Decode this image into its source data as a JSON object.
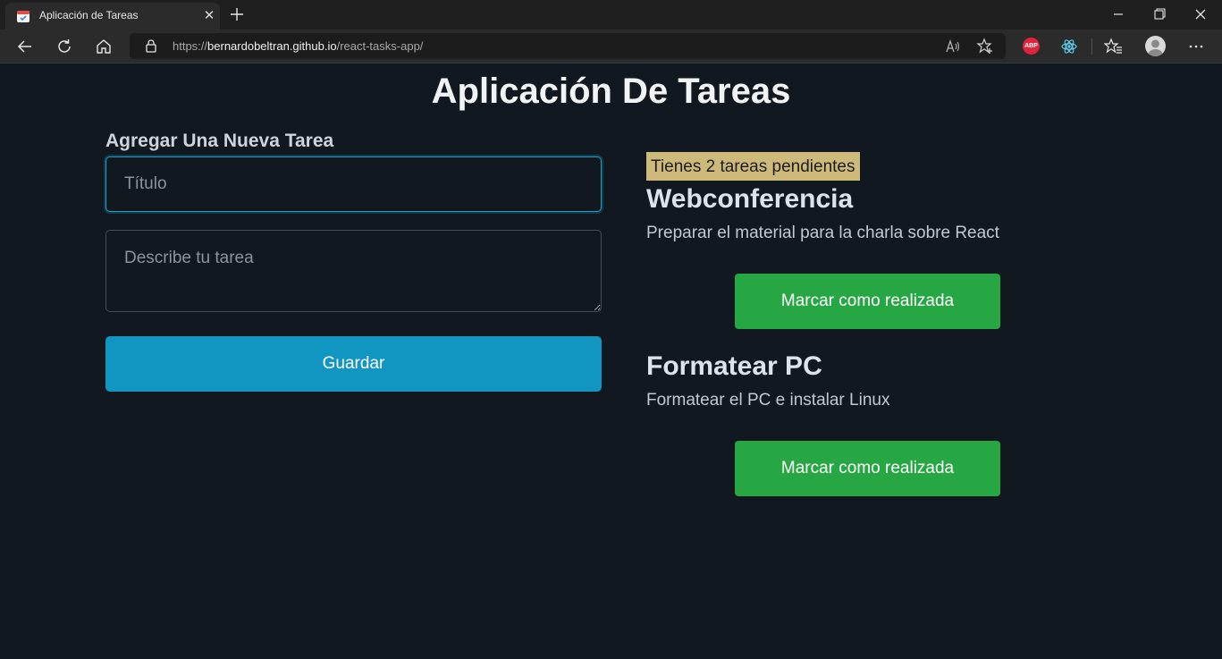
{
  "browser": {
    "tab_title": "Aplicación de Tareas",
    "tab_close": "✕",
    "url_scheme": "https://",
    "url_host": "bernardobeltran.github.io",
    "url_path": "/react-tasks-app/",
    "extension_abp": "ABP"
  },
  "page": {
    "title": "Aplicación De Tareas"
  },
  "form": {
    "heading": "Agregar Una Nueva Tarea",
    "title_placeholder": "Título",
    "description_placeholder": "Describe tu tarea",
    "save_label": "Guardar"
  },
  "tasks": {
    "pending_text": "Tienes 2 tareas pendientes",
    "items": [
      {
        "title": "Webconferencia",
        "description": "Preparar el material para la charla sobre React",
        "button_label": "Marcar como realizada"
      },
      {
        "title": "Formatear PC",
        "description": "Formatear el PC e instalar Linux",
        "button_label": "Marcar como realizada"
      }
    ]
  },
  "colors": {
    "page_background": "#111820",
    "primary_button": "#1196c1",
    "success_button": "#27a744",
    "badge": "#cdb97a"
  }
}
